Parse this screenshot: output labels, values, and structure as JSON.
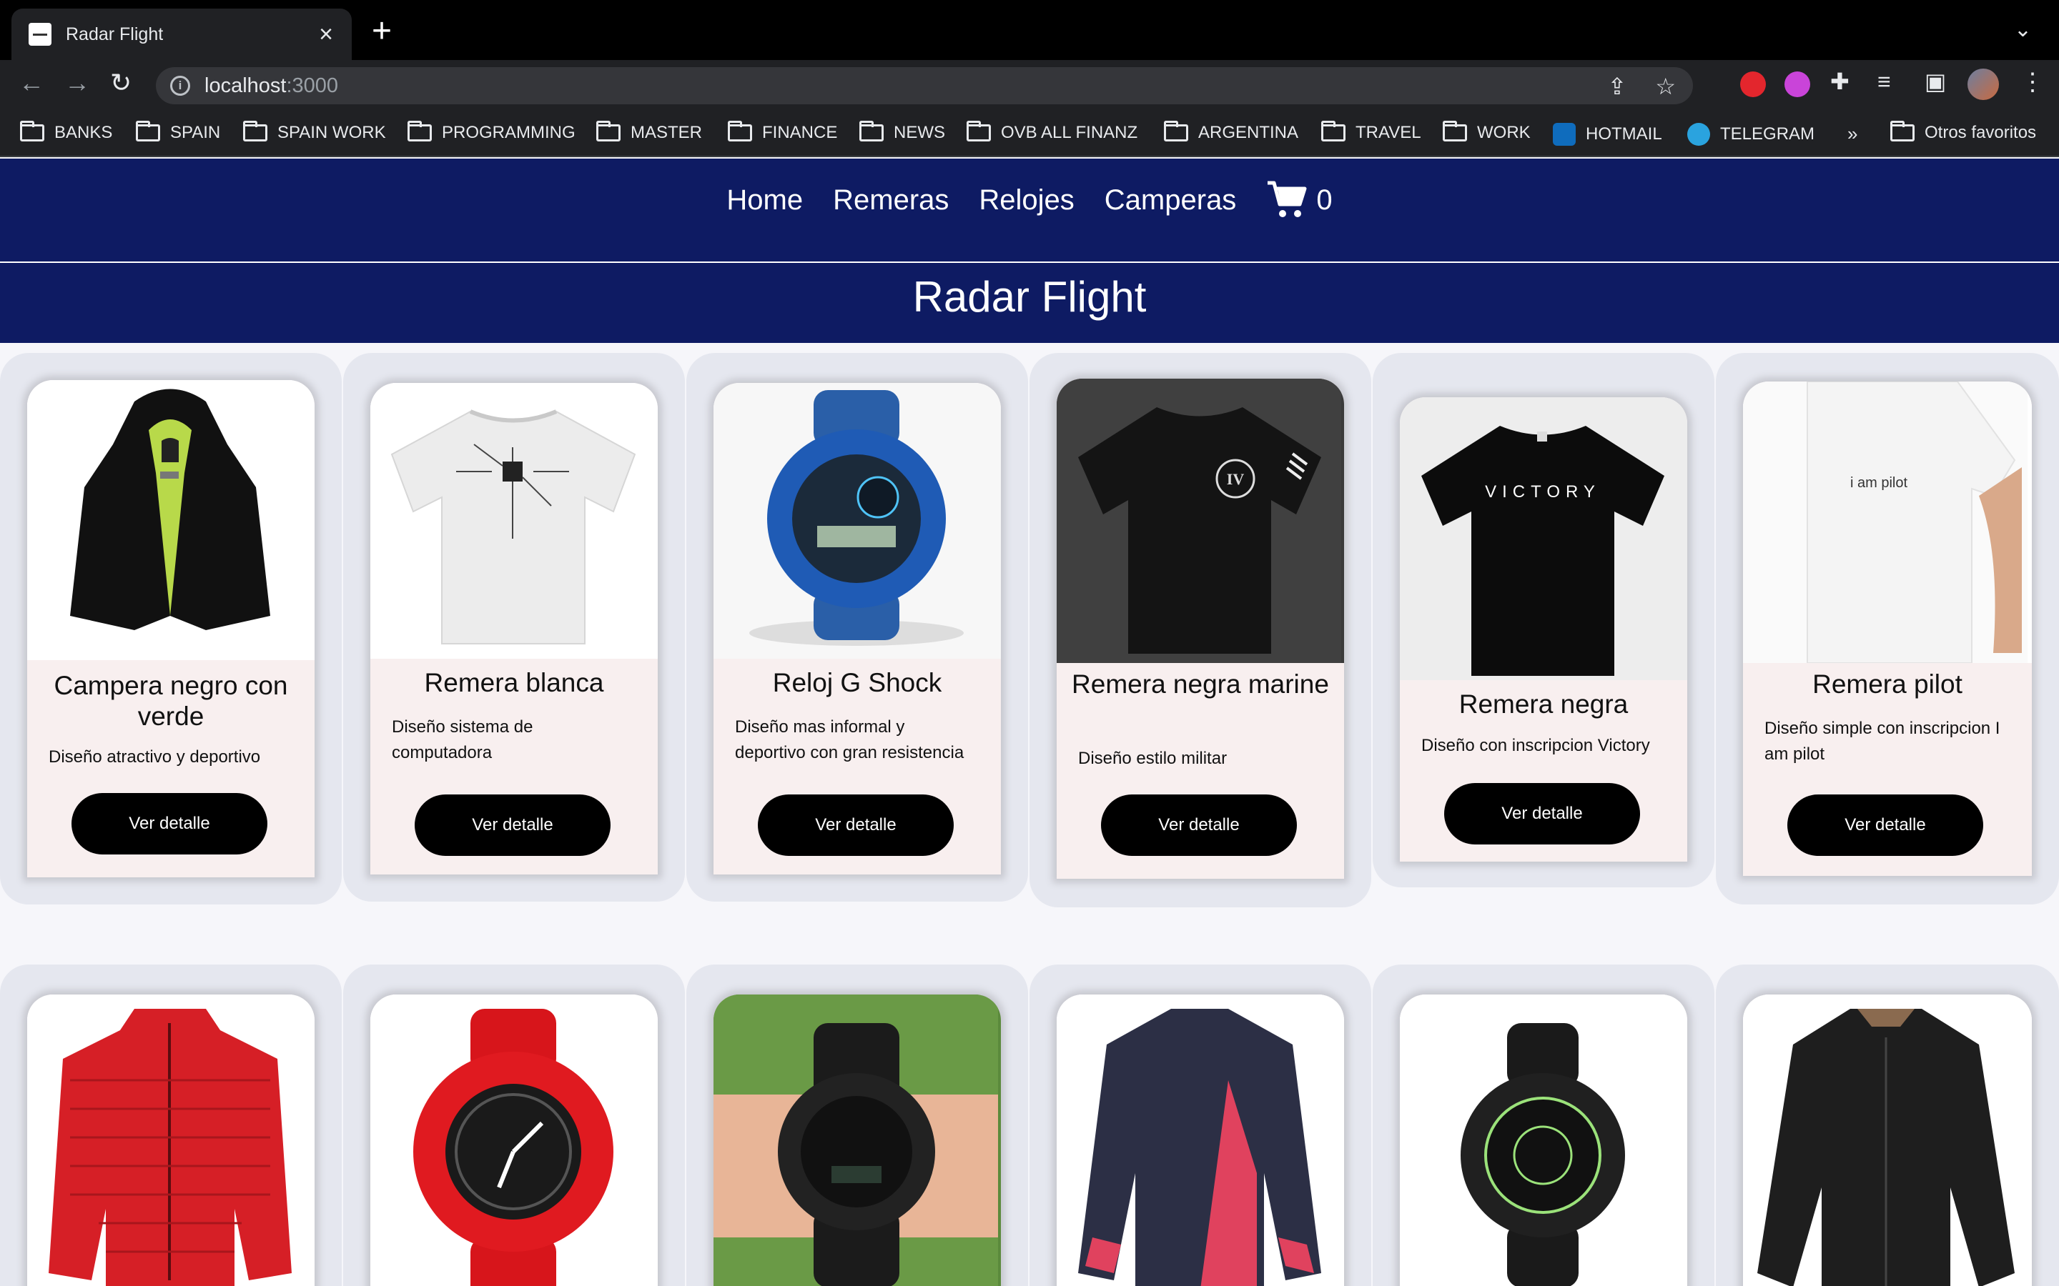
{
  "browser": {
    "tab_title": "Radar Flight",
    "url_host": "localhost",
    "url_port": ":3000",
    "bookmarks": [
      {
        "label": "BANKS",
        "icon": "folder-icon"
      },
      {
        "label": "SPAIN",
        "icon": "folder-icon"
      },
      {
        "label": "SPAIN WORK",
        "icon": "folder-icon"
      },
      {
        "label": "PROGRAMMING",
        "icon": "folder-icon"
      },
      {
        "label": "MASTER",
        "icon": "folder-icon"
      },
      {
        "label": "FINANCE",
        "icon": "folder-icon"
      },
      {
        "label": "NEWS",
        "icon": "folder-icon"
      },
      {
        "label": "OVB ALL FINANZ",
        "icon": "folder-icon"
      },
      {
        "label": "ARGENTINA",
        "icon": "folder-icon"
      },
      {
        "label": "TRAVEL",
        "icon": "folder-icon"
      },
      {
        "label": "WORK",
        "icon": "folder-icon"
      },
      {
        "label": "HOTMAIL",
        "icon": "outlook-icon"
      },
      {
        "label": "TELEGRAM",
        "icon": "telegram-icon"
      }
    ],
    "bookmarks_overflow": "»",
    "other_bookmarks": "Otros favoritos"
  },
  "nav": {
    "links": [
      "Home",
      "Remeras",
      "Relojes",
      "Camperas"
    ],
    "cart_count": "0"
  },
  "site_title": "Radar Flight",
  "products_row1": [
    {
      "title": "Campera negro con verde",
      "description": "Diseño atractivo y deportivo",
      "button": "Ver detalle",
      "image": "black-green-jacket"
    },
    {
      "title": "Remera blanca",
      "description": "Diseño sistema de computadora",
      "button": "Ver detalle",
      "image": "white-circuit-tshirt"
    },
    {
      "title": "Reloj G Shock",
      "description": "Diseño mas informal y deportivo con gran resistencia",
      "button": "Ver detalle",
      "image": "blue-g-shock-watch"
    },
    {
      "title": "Remera negra marine",
      "description": "Diseño estilo militar",
      "button": "Ver detalle",
      "image": "black-marine-tshirt"
    },
    {
      "title": "Remera negra",
      "description": "Diseño con inscripcion Victory",
      "button": "Ver detalle",
      "image": "black-victory-tshirt"
    },
    {
      "title": "Remera pilot",
      "description": "Diseño simple con inscripcion I am pilot",
      "button": "Ver detalle",
      "image": "white-pilot-tshirt"
    }
  ],
  "products_row2": [
    {
      "image": "red-puffer-jacket"
    },
    {
      "image": "red-g-shock-watch"
    },
    {
      "image": "black-g-shock-on-wrist"
    },
    {
      "image": "navy-red-sport-jacket"
    },
    {
      "image": "black-green-g-shock-watch"
    },
    {
      "image": "black-leather-jacket"
    }
  ],
  "image_text": {
    "victory": "VICTORY",
    "pilot": "i am pilot"
  }
}
